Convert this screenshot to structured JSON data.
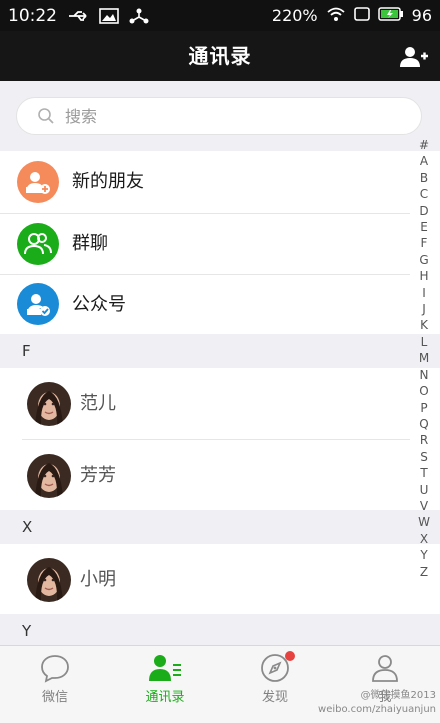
{
  "status_bar": {
    "time": "10:22",
    "signal_text": "220%",
    "battery_text": "96"
  },
  "header": {
    "title": "通讯录"
  },
  "search": {
    "placeholder": "搜索"
  },
  "special_rows": [
    {
      "label": "新的朋友",
      "color": "#f58a5b"
    },
    {
      "label": "群聊",
      "color": "#1aad19"
    },
    {
      "label": "公众号",
      "color": "#1a8bd6"
    }
  ],
  "sections": [
    {
      "letter": "F",
      "contacts": [
        "范儿",
        "芳芳"
      ]
    },
    {
      "letter": "X",
      "contacts": [
        "小明"
      ]
    },
    {
      "letter": "Y",
      "contacts": []
    }
  ],
  "index_letters": [
    "#",
    "A",
    "B",
    "C",
    "D",
    "E",
    "F",
    "G",
    "H",
    "I",
    "J",
    "K",
    "L",
    "M",
    "N",
    "O",
    "P",
    "Q",
    "R",
    "S",
    "T",
    "U",
    "V",
    "W",
    "X",
    "Y",
    "Z"
  ],
  "tabs": [
    {
      "label": "微信",
      "active": false
    },
    {
      "label": "通讯录",
      "active": true
    },
    {
      "label": "发现",
      "active": false
    },
    {
      "label": "我",
      "active": false
    }
  ],
  "watermark": {
    "line1": "@微信摸鱼2013",
    "line2": "weibo.com/zhaiyuanjun"
  },
  "colors": {
    "accent_green": "#1aad19",
    "title_bar": "#161616",
    "badge_red": "#e64340"
  }
}
